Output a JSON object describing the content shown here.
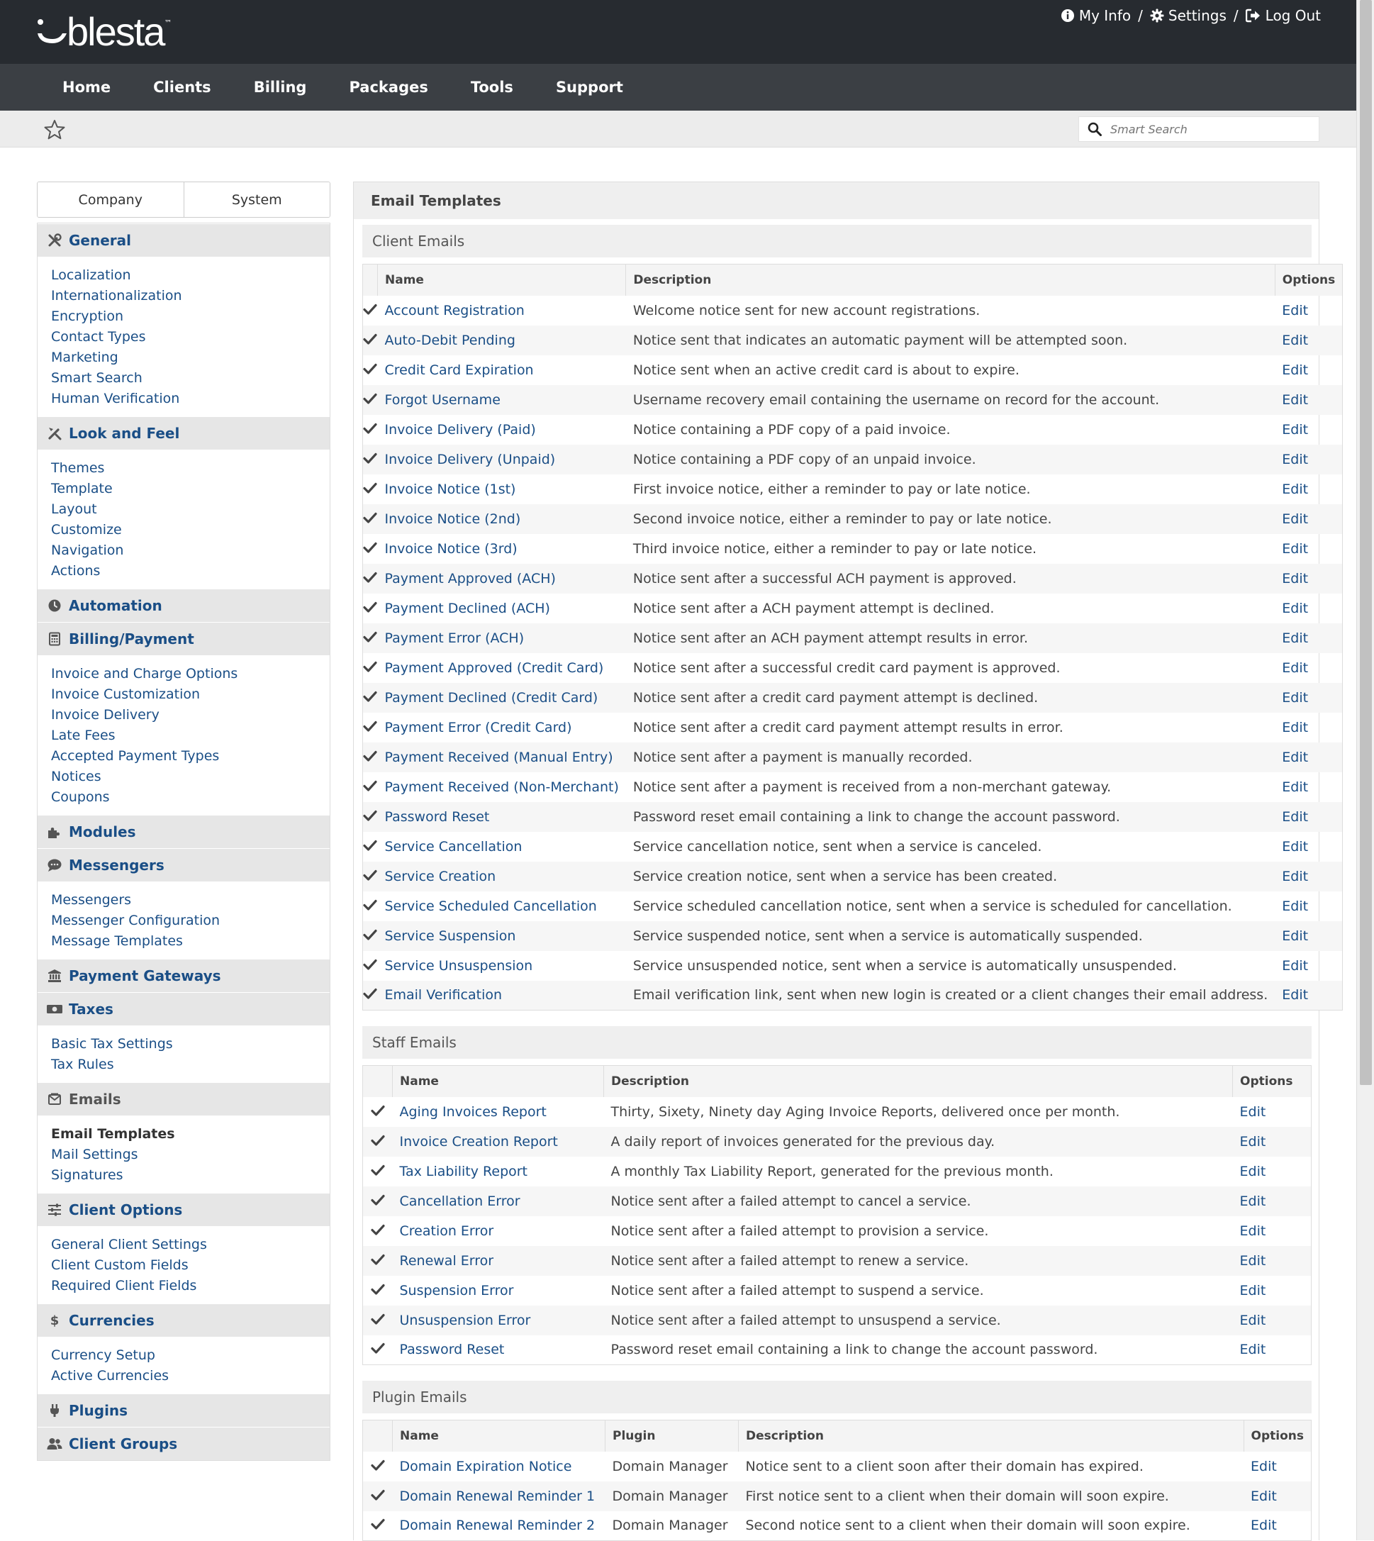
{
  "brand": {
    "name": "blesta"
  },
  "top_links": [
    {
      "label": "My Info",
      "icon": "info-circle-icon"
    },
    {
      "label": "Settings",
      "icon": "gear-icon"
    },
    {
      "label": "Log Out",
      "icon": "logout-icon"
    }
  ],
  "top_sep": "/",
  "nav": [
    "Home",
    "Clients",
    "Billing",
    "Packages",
    "Tools",
    "Support"
  ],
  "search": {
    "placeholder": "Smart Search"
  },
  "settings_tabs": [
    "Company",
    "System"
  ],
  "sidebar": [
    {
      "title": "General",
      "icon": "tools-icon",
      "items": [
        "Localization",
        "Internationalization",
        "Encryption",
        "Contact Types",
        "Marketing",
        "Smart Search",
        "Human Verification"
      ]
    },
    {
      "title": "Look and Feel",
      "icon": "paint-tools-icon",
      "items": [
        "Themes",
        "Template",
        "Layout",
        "Customize",
        "Navigation",
        "Actions"
      ]
    },
    {
      "title": "Automation",
      "icon": "clock-icon",
      "items": []
    },
    {
      "title": "Billing/Payment",
      "icon": "calculator-icon",
      "items": [
        "Invoice and Charge Options",
        "Invoice Customization",
        "Invoice Delivery",
        "Late Fees",
        "Accepted Payment Types",
        "Notices",
        "Coupons"
      ]
    },
    {
      "title": "Modules",
      "icon": "puzzle-icon",
      "items": []
    },
    {
      "title": "Messengers",
      "icon": "chat-bubble-icon",
      "items": [
        "Messengers",
        "Messenger Configuration",
        "Message Templates"
      ]
    },
    {
      "title": "Payment Gateways",
      "icon": "bank-icon",
      "items": []
    },
    {
      "title": "Taxes",
      "icon": "money-icon",
      "items": [
        "Basic Tax Settings",
        "Tax Rules"
      ]
    },
    {
      "title": "Emails",
      "icon": "envelope-icon",
      "active": true,
      "items": [
        "Email Templates",
        "Mail Settings",
        "Signatures"
      ]
    },
    {
      "title": "Client Options",
      "icon": "sliders-icon",
      "items": [
        "General Client Settings",
        "Client Custom Fields",
        "Required Client Fields"
      ]
    },
    {
      "title": "Currencies",
      "icon": "dollar-icon",
      "items": [
        "Currency Setup",
        "Active Currencies"
      ]
    },
    {
      "title": "Plugins",
      "icon": "plug-icon",
      "items": []
    },
    {
      "title": "Client Groups",
      "icon": "users-icon",
      "items": []
    }
  ],
  "active_item": "Email Templates",
  "main": {
    "title": "Email Templates",
    "edit_label": "Edit",
    "client_emails": {
      "title": "Client Emails",
      "headers": [
        "Name",
        "Description",
        "Options"
      ],
      "rows": [
        [
          "Account Registration",
          "Welcome notice sent for new account registrations."
        ],
        [
          "Auto-Debit Pending",
          "Notice sent that indicates an automatic payment will be attempted soon."
        ],
        [
          "Credit Card Expiration",
          "Notice sent when an active credit card is about to expire."
        ],
        [
          "Forgot Username",
          "Username recovery email containing the username on record for the account."
        ],
        [
          "Invoice Delivery (Paid)",
          "Notice containing a PDF copy of a paid invoice."
        ],
        [
          "Invoice Delivery (Unpaid)",
          "Notice containing a PDF copy of an unpaid invoice."
        ],
        [
          "Invoice Notice (1st)",
          "First invoice notice, either a reminder to pay or late notice."
        ],
        [
          "Invoice Notice (2nd)",
          "Second invoice notice, either a reminder to pay or late notice."
        ],
        [
          "Invoice Notice (3rd)",
          "Third invoice notice, either a reminder to pay or late notice."
        ],
        [
          "Payment Approved (ACH)",
          "Notice sent after a successful ACH payment is approved."
        ],
        [
          "Payment Declined (ACH)",
          "Notice sent after a ACH payment attempt is declined."
        ],
        [
          "Payment Error (ACH)",
          "Notice sent after an ACH payment attempt results in error."
        ],
        [
          "Payment Approved (Credit Card)",
          "Notice sent after a successful credit card payment is approved."
        ],
        [
          "Payment Declined (Credit Card)",
          "Notice sent after a credit card payment attempt is declined."
        ],
        [
          "Payment Error (Credit Card)",
          "Notice sent after a credit card payment attempt results in error."
        ],
        [
          "Payment Received (Manual Entry)",
          "Notice sent after a payment is manually recorded."
        ],
        [
          "Payment Received (Non-Merchant)",
          "Notice sent after a payment is received from a non-merchant gateway."
        ],
        [
          "Password Reset",
          "Password reset email containing a link to change the account password."
        ],
        [
          "Service Cancellation",
          "Service cancellation notice, sent when a service is canceled."
        ],
        [
          "Service Creation",
          "Service creation notice, sent when a service has been created."
        ],
        [
          "Service Scheduled Cancellation",
          "Service scheduled cancellation notice, sent when a service is scheduled for cancellation."
        ],
        [
          "Service Suspension",
          "Service suspended notice, sent when a service is automatically suspended."
        ],
        [
          "Service Unsuspension",
          "Service unsuspended notice, sent when a service is automatically unsuspended."
        ],
        [
          "Email Verification",
          "Email verification link, sent when new login is created or a client changes their email address."
        ]
      ]
    },
    "staff_emails": {
      "title": "Staff Emails",
      "headers": [
        "Name",
        "Description",
        "Options"
      ],
      "rows": [
        [
          "Aging Invoices Report",
          "Thirty, Sixety, Ninety day Aging Invoice Reports, delivered once per month."
        ],
        [
          "Invoice Creation Report",
          "A daily report of invoices generated for the previous day."
        ],
        [
          "Tax Liability Report",
          "A monthly Tax Liability Report, generated for the previous month."
        ],
        [
          "Cancellation Error",
          "Notice sent after a failed attempt to cancel a service."
        ],
        [
          "Creation Error",
          "Notice sent after a failed attempt to provision a service."
        ],
        [
          "Renewal Error",
          "Notice sent after a failed attempt to renew a service."
        ],
        [
          "Suspension Error",
          "Notice sent after a failed attempt to suspend a service."
        ],
        [
          "Unsuspension Error",
          "Notice sent after a failed attempt to unsuspend a service."
        ],
        [
          "Password Reset",
          "Password reset email containing a link to change the account password."
        ]
      ]
    },
    "plugin_emails": {
      "title": "Plugin Emails",
      "headers": [
        "Name",
        "Plugin",
        "Description",
        "Options"
      ],
      "rows": [
        [
          "Domain Expiration Notice",
          "Domain Manager",
          "Notice sent to a client soon after their domain has expired."
        ],
        [
          "Domain Renewal Reminder 1",
          "Domain Manager",
          "First notice sent to a client when their domain will soon expire."
        ],
        [
          "Domain Renewal Reminder 2",
          "Domain Manager",
          "Second notice sent to a client when their domain will soon expire."
        ]
      ]
    }
  }
}
